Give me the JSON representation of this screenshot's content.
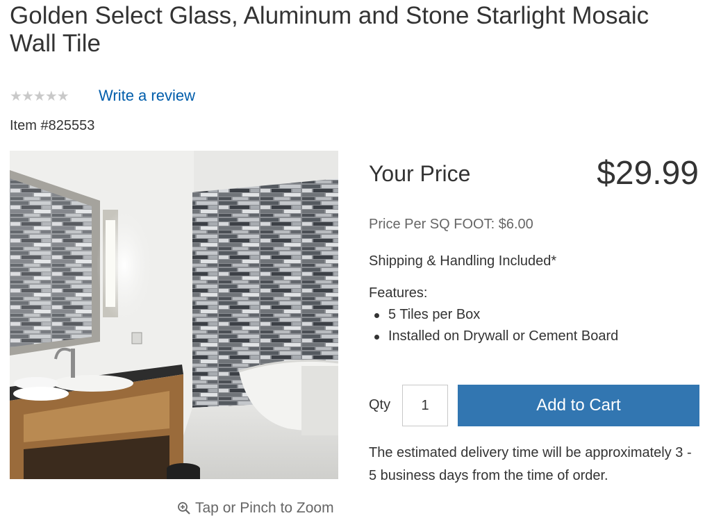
{
  "product": {
    "title": "Golden Select Glass, Aluminum and Stone Starlight Mosaic Wall Tile",
    "item_number": "Item #825553",
    "rating_stars": 0,
    "write_review": "Write a review",
    "zoom_hint": "Tap or Pinch to Zoom"
  },
  "pricing": {
    "your_price_label": "Your Price",
    "price": "$29.99",
    "price_per_unit": "Price Per SQ FOOT: $6.00",
    "shipping": "Shipping & Handling Included*"
  },
  "features": {
    "label": "Features:",
    "items": [
      "5 Tiles per Box",
      "Installed on Drywall or Cement Board"
    ]
  },
  "cart": {
    "qty_label": "Qty",
    "qty_value": "1",
    "add_to_cart": "Add to Cart",
    "button_color": "#3276b1"
  },
  "delivery_text": "The estimated delivery time will be approximately 3 - 5 business days from the time of order.",
  "colors": {
    "link": "#005dab",
    "star_empty": "#c9c9c9"
  }
}
